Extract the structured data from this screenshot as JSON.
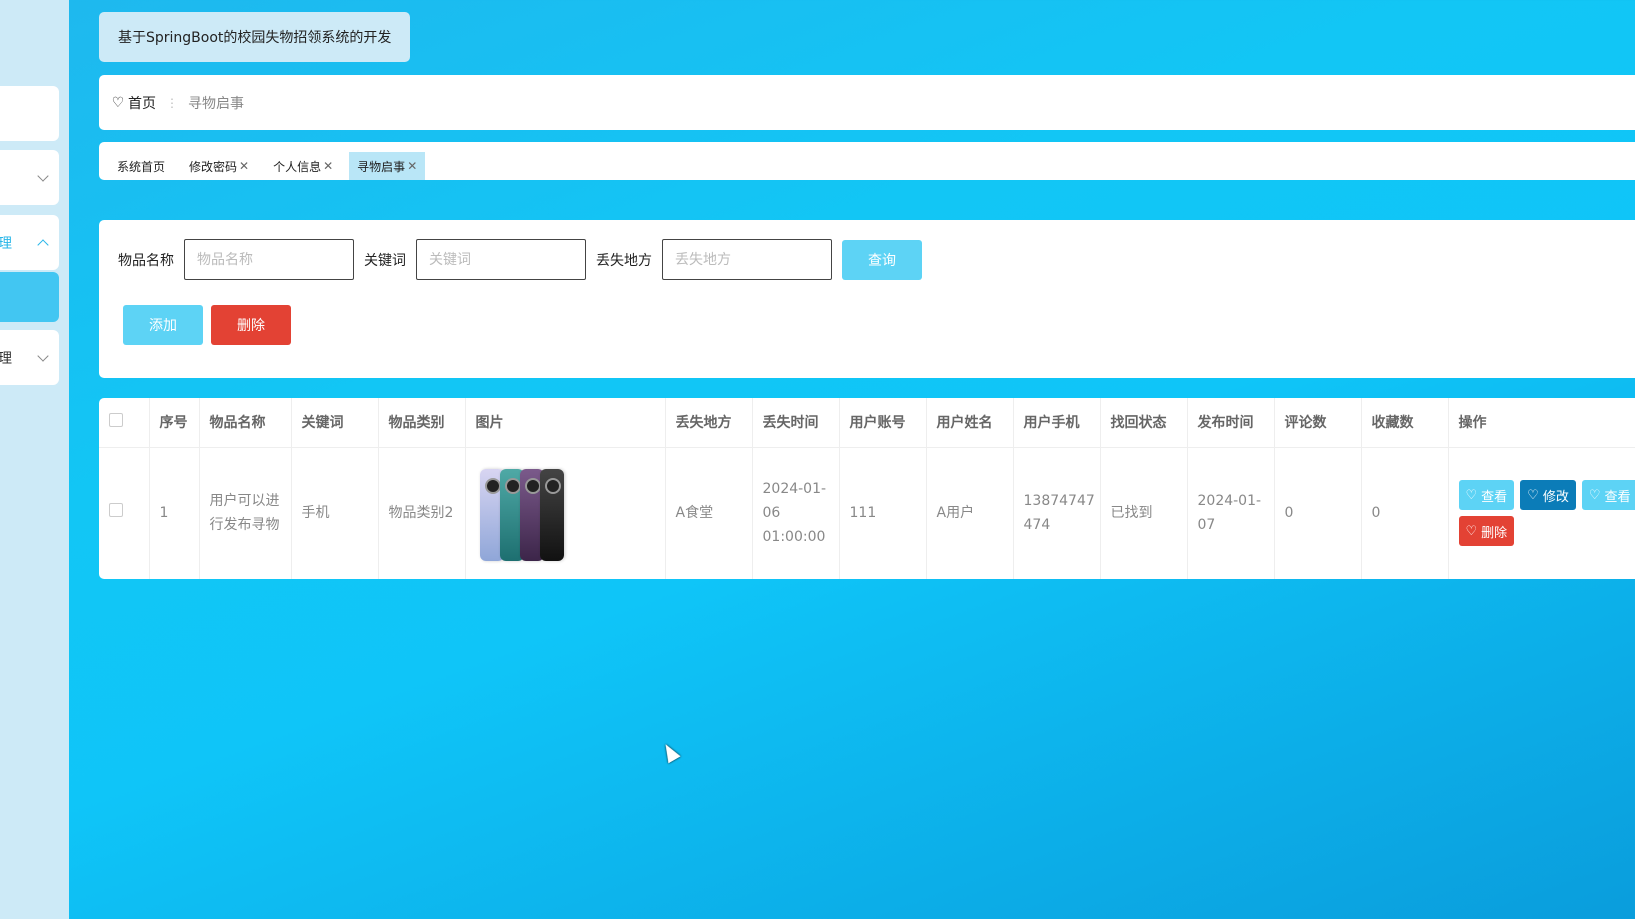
{
  "app": {
    "title": "基于SpringBoot的校园失物招领系统的开发"
  },
  "sidebar": {
    "items": [
      {
        "label": "",
        "chevron": ""
      },
      {
        "label": "",
        "chevron": "down"
      },
      {
        "label": "理",
        "chevron": "up"
      },
      {
        "label": "",
        "chevron": ""
      },
      {
        "label": "理",
        "chevron": "down"
      }
    ]
  },
  "breadcrumb": {
    "home": "首页",
    "separator": "⋮",
    "current": "寻物启事"
  },
  "tabs": [
    {
      "label": "系统首页",
      "closable": false
    },
    {
      "label": "修改密码",
      "closable": true
    },
    {
      "label": "个人信息",
      "closable": true
    },
    {
      "label": "寻物启事",
      "closable": true,
      "active": true
    }
  ],
  "search": {
    "name_label": "物品名称",
    "name_placeholder": "物品名称",
    "keyword_label": "关键词",
    "keyword_placeholder": "关键词",
    "place_label": "丢失地方",
    "place_placeholder": "丢失地方",
    "query_label": "查询",
    "add_label": "添加",
    "delete_label": "删除"
  },
  "table": {
    "headers": [
      "序号",
      "物品名称",
      "关键词",
      "物品类别",
      "图片",
      "丢失地方",
      "丢失时间",
      "用户账号",
      "用户姓名",
      "用户手机",
      "找回状态",
      "发布时间",
      "评论数",
      "收藏数",
      "操作"
    ],
    "rows": [
      {
        "index": "1",
        "name": "用户可以进行发布寻物",
        "keyword": "手机",
        "category": "物品类别2",
        "place": "A食堂",
        "lost_time": "2024-01-06 01:00:00",
        "account": "111",
        "username": "A用户",
        "phone": "13874747474",
        "status": "已找到",
        "publish_time": "2024-01-07",
        "comments": "0",
        "favorites": "0",
        "ops": {
          "view": "查看",
          "edit": "修改",
          "view2": "查看",
          "delete": "删除"
        }
      }
    ]
  },
  "icons": {
    "heart": "heart-icon",
    "close": "close-icon",
    "chevron": "chevron-icon"
  },
  "colors": {
    "accent": "#5dd3f5",
    "danger": "#e34234",
    "edit": "#0b7cb8"
  }
}
